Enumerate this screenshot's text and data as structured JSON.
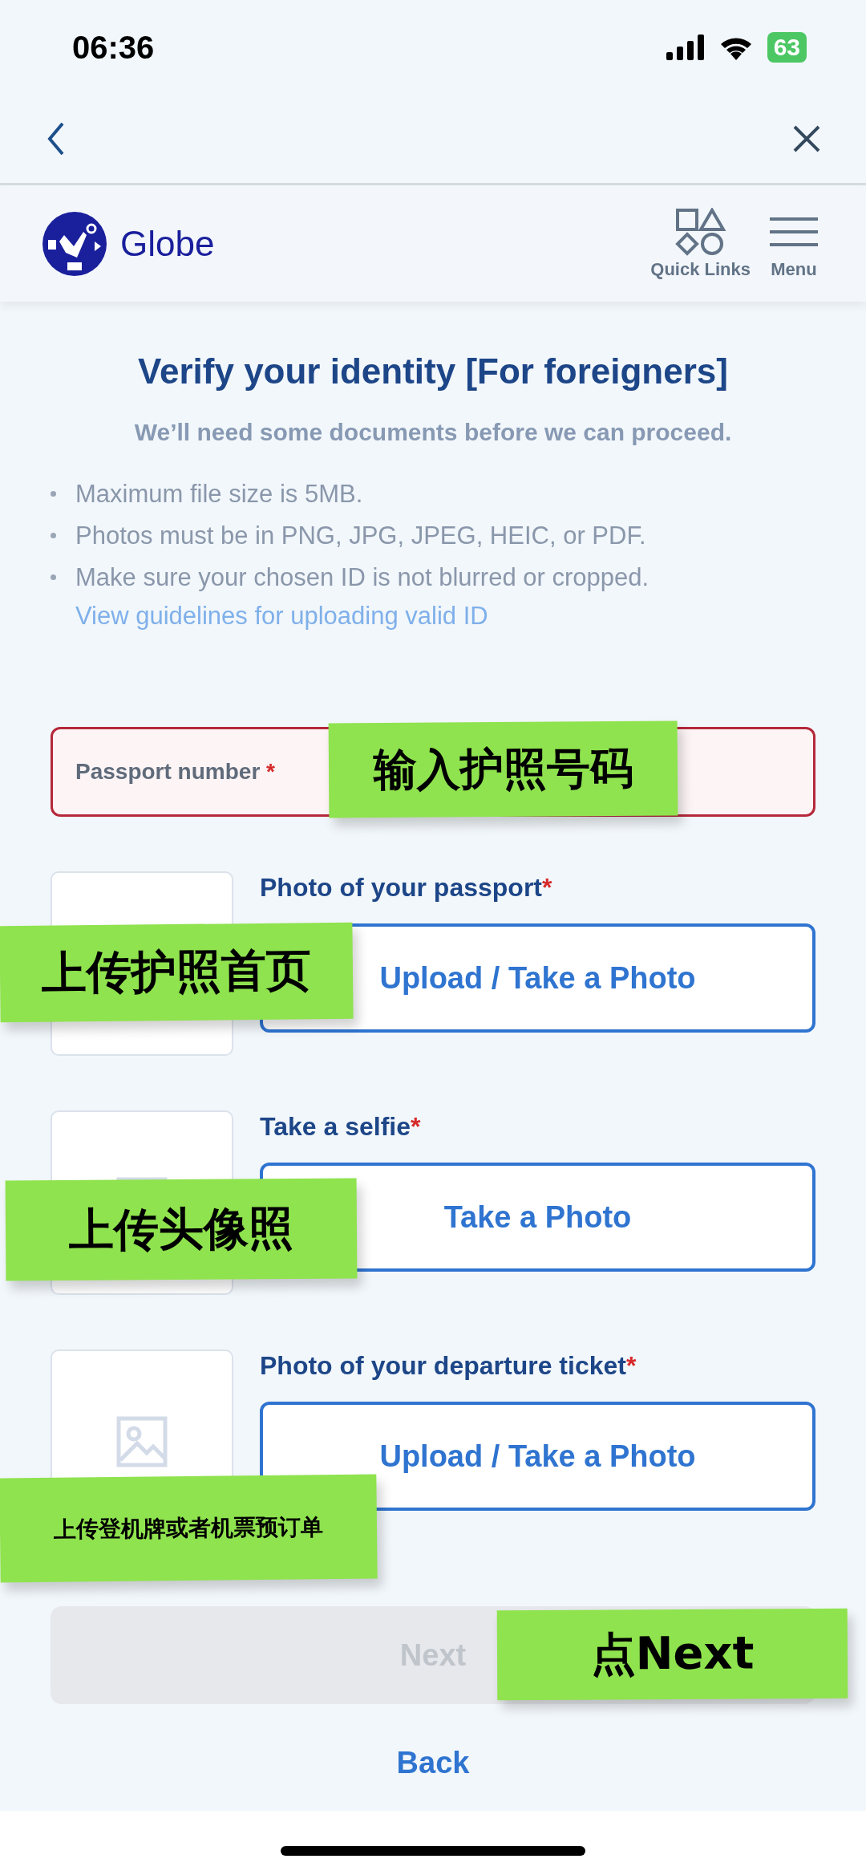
{
  "status_bar": {
    "time": "06:36",
    "battery": "63"
  },
  "header": {
    "brand": "Globe",
    "quick_links": "Quick Links",
    "menu": "Menu"
  },
  "title": "Verify your identity [For foreigners]",
  "subtitle": "We’ll need some documents before we can proceed.",
  "bullets": [
    {
      "text": "Maximum file size is 5MB."
    },
    {
      "text": "Photos must be in PNG, JPG, JPEG, HEIC, or PDF."
    },
    {
      "text": "Make sure your chosen ID is not blurred or cropped.",
      "link": "View guidelines for uploading valid ID"
    }
  ],
  "passport_field": {
    "placeholder": "Passport number",
    "required_mark": "*",
    "error": true
  },
  "uploads": [
    {
      "label": "Photo of your passport",
      "required_mark": "*",
      "button": "Upload / Take a Photo"
    },
    {
      "label": "Take a selfie",
      "required_mark": "*",
      "button": "Take a Photo"
    },
    {
      "label": "Photo of your departure ticket",
      "required_mark": "*",
      "button": "Upload / Take a Photo"
    }
  ],
  "next_button": {
    "label": "Next",
    "disabled": true
  },
  "back_link": "Back",
  "notes": [
    {
      "text": "输入护照号码"
    },
    {
      "text": "上传护照首页"
    },
    {
      "text": "上传头像照"
    },
    {
      "text": "上传登机牌或者机票预订单"
    },
    {
      "text": "点Next"
    }
  ]
}
